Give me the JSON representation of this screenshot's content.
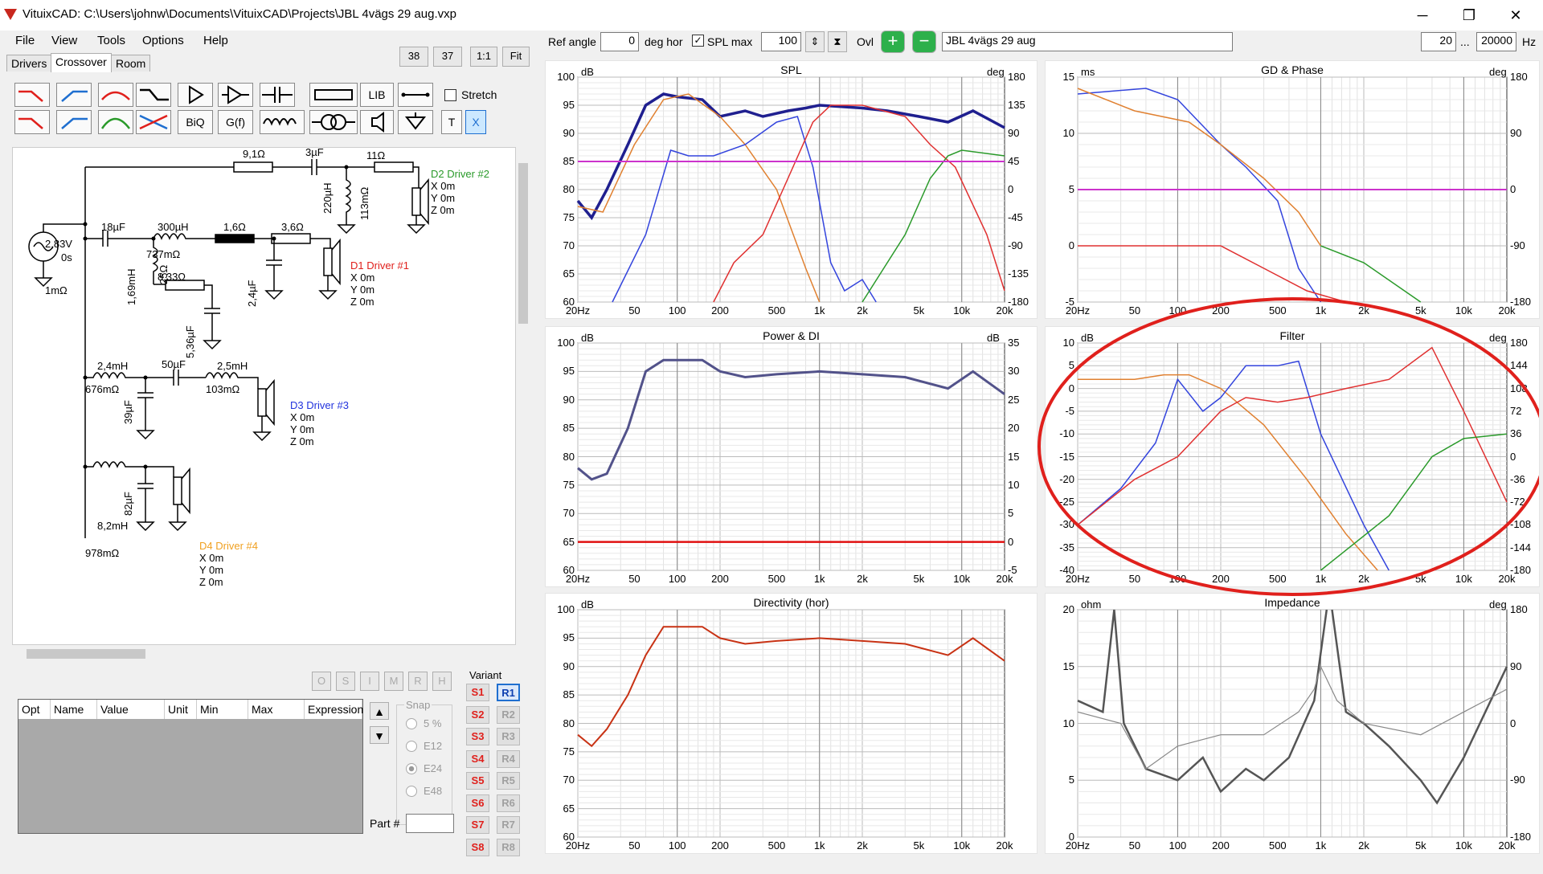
{
  "window": {
    "title": "VituixCAD: C:\\Users\\johnw\\Documents\\VituixCAD\\Projects\\JBL 4vägs 29 aug.vxp",
    "min": "─",
    "restore": "❐",
    "close": "✕"
  },
  "menu": [
    "File",
    "View",
    "Tools",
    "Options",
    "Help"
  ],
  "zoom_buttons": [
    "38",
    "37",
    "1:1",
    "Fit"
  ],
  "tabs": [
    "Drivers",
    "Crossover",
    "Room"
  ],
  "toolbar": {
    "lib": "LIB",
    "biq": "BiQ",
    "gf": "G(f)",
    "t": "T",
    "x": "X",
    "stretch": "Stretch"
  },
  "top": {
    "ref_angle_label": "Ref angle",
    "ref_angle_value": "0",
    "deg_hor": "deg hor",
    "spl_max_label": "SPL max",
    "spl_max_value": "100",
    "ovl": "Ovl",
    "project_name": "JBL 4vägs 29 aug",
    "f_min": "20",
    "dots": "...",
    "f_max": "20000",
    "hz": "Hz"
  },
  "schematic": {
    "source": {
      "v": "2,83V",
      "t": "0s",
      "r": "1mΩ"
    },
    "labels": [
      "9,1Ω",
      "3µF",
      "11Ω",
      "220µH",
      "113mΩ",
      "18µF",
      "300µH",
      "737mΩ",
      "1,6Ω",
      "3,6Ω",
      "1,69mH",
      "25Ω",
      "8,33Ω",
      "5,36µF",
      "2,4µF",
      "2,4mH",
      "676mΩ",
      "50µF",
      "2,5mH",
      "103mΩ",
      "39µF",
      "8,2mH",
      "978mΩ",
      "82µF"
    ],
    "drivers": [
      {
        "name": "D2 Driver #2",
        "color": "#2a9a2a",
        "x": "X 0m",
        "y": "Y 0m",
        "z": "Z 0m"
      },
      {
        "name": "D1 Driver #1",
        "color": "#e0201c",
        "x": "X 0m",
        "y": "Y 0m",
        "z": "Z 0m"
      },
      {
        "name": "D3 Driver #3",
        "color": "#2233dd",
        "x": "X 0m",
        "y": "Y 0m",
        "z": "Z 0m"
      },
      {
        "name": "D4 Driver #4",
        "color": "#f0a020",
        "x": "X 0m",
        "y": "Y 0m",
        "z": "Z 0m"
      }
    ]
  },
  "optimizer": {
    "buttons": [
      "O",
      "S",
      "I",
      "M",
      "R",
      "H"
    ],
    "columns": [
      "Opt",
      "Name",
      "Value",
      "Unit",
      "Min",
      "Max",
      "Expression"
    ],
    "snap_label": "Snap",
    "snap_options": [
      "5 %",
      "E12",
      "E24",
      "E48"
    ],
    "snap_selected": "E24",
    "part_label": "Part #"
  },
  "variant": {
    "label": "Variant",
    "s": [
      "S1",
      "S2",
      "S3",
      "S4",
      "S5",
      "S6",
      "S7",
      "S8"
    ],
    "r": [
      "R1",
      "R2",
      "R3",
      "R4",
      "R5",
      "R6",
      "R7",
      "R8"
    ],
    "selected": "R1"
  },
  "x_ticks": [
    "20Hz",
    "50",
    "100",
    "200",
    "500",
    "1k",
    "2k",
    "5k",
    "10k",
    "20k"
  ],
  "graphs": {
    "spl": {
      "title": "SPL",
      "unit_left": "dB",
      "unit_right": "deg",
      "y_left": [
        "100",
        "95",
        "90",
        "85",
        "80",
        "75",
        "70",
        "65",
        "60"
      ],
      "y_right": [
        "180",
        "135",
        "90",
        "45",
        "0",
        "-45",
        "-90",
        "-135",
        "-180"
      ]
    },
    "gd": {
      "title": "GD & Phase",
      "unit_left": "ms",
      "unit_right": "deg",
      "y_left": [
        "15",
        "10",
        "5",
        "0",
        "-5"
      ],
      "y_right": [
        "180",
        "90",
        "0",
        "-90",
        "-180"
      ]
    },
    "power": {
      "title": "Power & DI",
      "unit_left": "dB",
      "unit_right": "dB",
      "y_left": [
        "100",
        "95",
        "90",
        "85",
        "80",
        "75",
        "70",
        "65",
        "60"
      ],
      "y_right": [
        "35",
        "30",
        "25",
        "20",
        "15",
        "10",
        "5",
        "0",
        "-5"
      ]
    },
    "filter": {
      "title": "Filter",
      "unit_left": "dB",
      "unit_right": "deg",
      "y_left": [
        "10",
        "5",
        "0",
        "-5",
        "-10",
        "-15",
        "-20",
        "-25",
        "-30",
        "-35",
        "-40"
      ],
      "y_right": [
        "180",
        "144",
        "108",
        "72",
        "36",
        "0",
        "-36",
        "-72",
        "-108",
        "-144",
        "-180"
      ]
    },
    "directivity": {
      "title": "Directivity (hor)",
      "unit_left": "dB",
      "y_left": [
        "100",
        "95",
        "90",
        "85",
        "80",
        "75",
        "70",
        "65",
        "60"
      ]
    },
    "impedance": {
      "title": "Impedance",
      "unit_left": "ohm",
      "unit_right": "deg",
      "y_left": [
        "20",
        "15",
        "10",
        "5",
        "0"
      ],
      "y_right": [
        "180",
        "90",
        "0",
        "-90",
        "-180"
      ]
    }
  }
}
